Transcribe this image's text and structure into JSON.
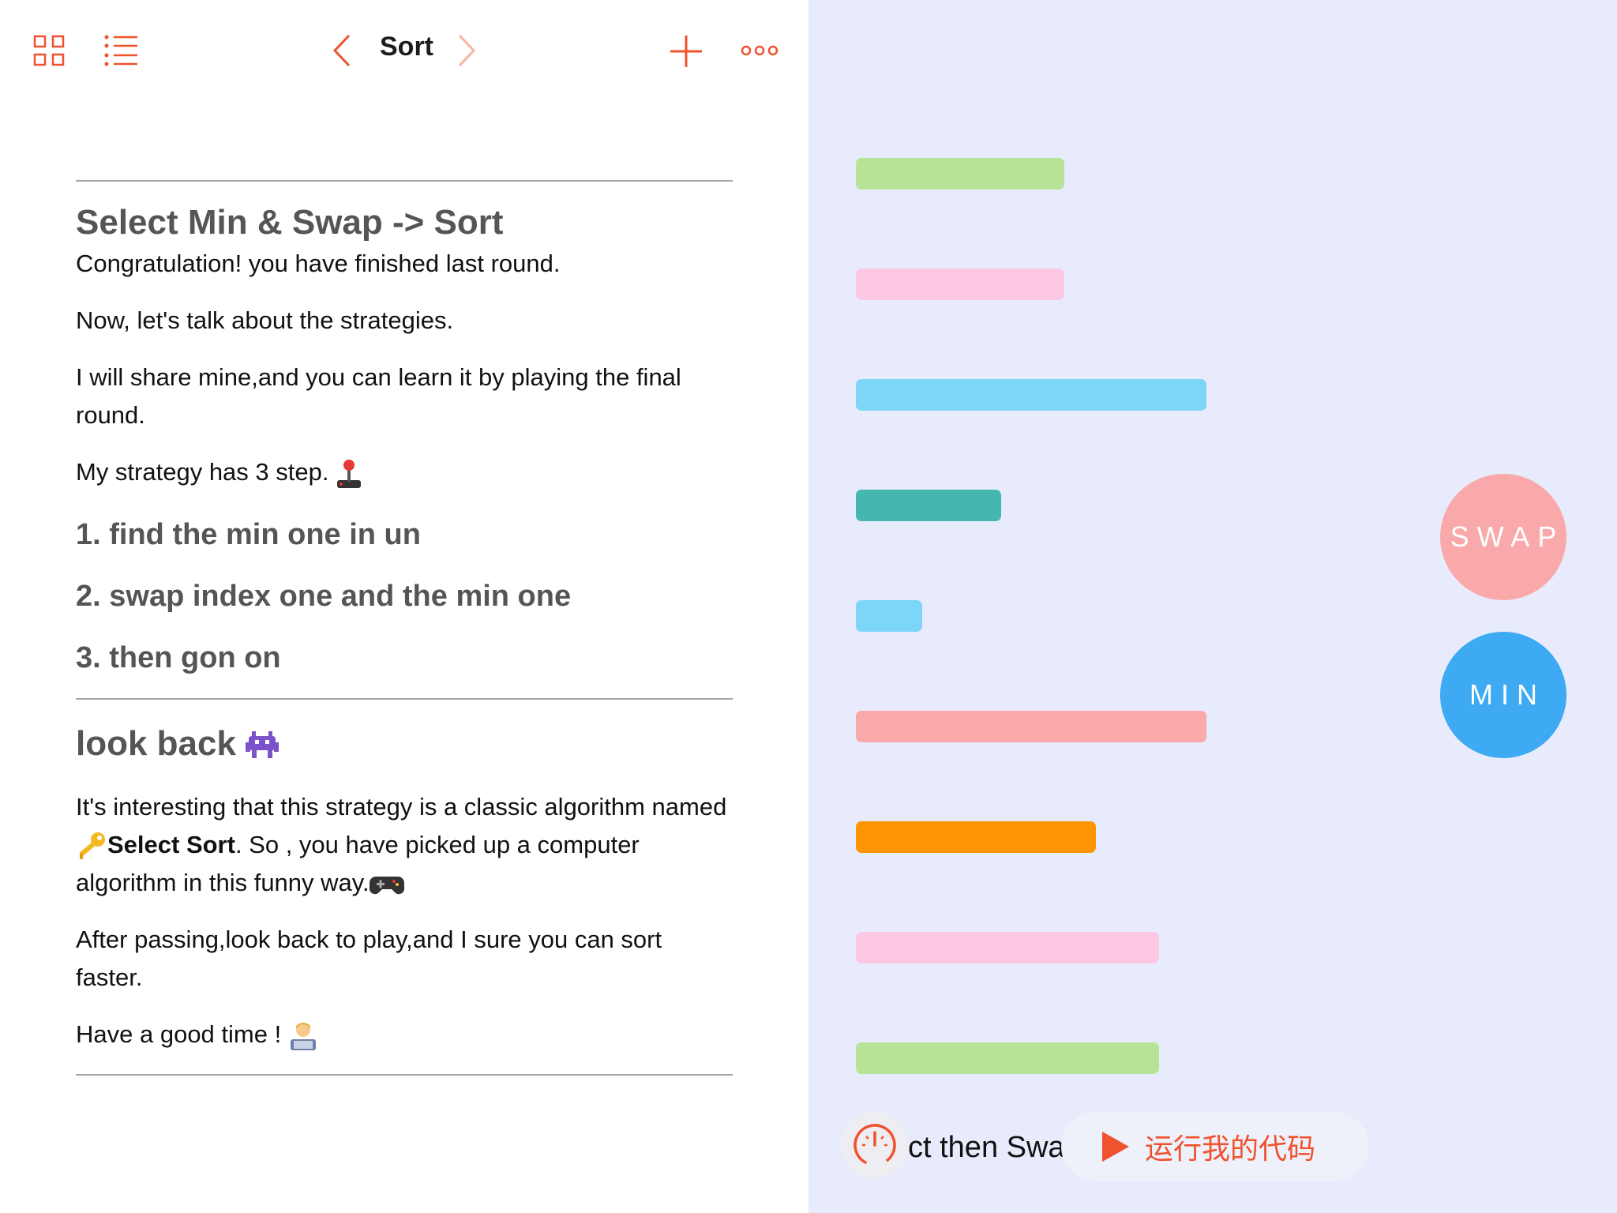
{
  "toolbar": {
    "title": "Sort",
    "icons": [
      "grid-icon",
      "list-icon",
      "chevron-left-icon",
      "chevron-right-icon",
      "plus-icon",
      "more-icon"
    ],
    "accent_color": "#f0522e"
  },
  "document": {
    "section1": {
      "heading": "Select Min & Swap -> Sort",
      "p1": "Congratulation! you have finished last round.",
      "p2": "Now, let's talk about the strategies.",
      "p3": "I will share mine,and you can learn it by playing the final round.",
      "p4": "My strategy has 3 step.",
      "steps": [
        "1. find the min one in un",
        "2. swap index one and the min one",
        "3. then gon on"
      ]
    },
    "section2": {
      "heading": "look back",
      "p1_before": "It's interesting that this strategy is a classic algorithm named ",
      "p1_bold": "Select Sort",
      "p1_after": ". So , you have picked up a computer algorithm in this funny way.",
      "p2": "After passing,look back to play,and I sure you can sort faster.",
      "p3": "Have a good time !"
    }
  },
  "live_view": {
    "background": "#e8ebfc",
    "bars": [
      {
        "value": 13,
        "color": "#b7e397"
      },
      {
        "value": 13,
        "color": "#fec8e5"
      },
      {
        "value": 22,
        "color": "#7dd5f8"
      },
      {
        "value": 9,
        "color": "#45b7b1"
      },
      {
        "value": 4,
        "color": "#7dd5f8"
      },
      {
        "value": 22,
        "color": "#f9a9a9"
      },
      {
        "value": 15,
        "color": "#fe9505"
      },
      {
        "value": 19,
        "color": "#fec8e5"
      },
      {
        "value": 19,
        "color": "#b7e397"
      }
    ],
    "swap_button": {
      "label": "SWAP",
      "color": "#f9a9a9"
    },
    "min_button": {
      "label": "MIN",
      "color": "#3daaf3"
    },
    "code_snippet": "ct then Swa",
    "run_button": {
      "label": "运行我的代码"
    }
  }
}
